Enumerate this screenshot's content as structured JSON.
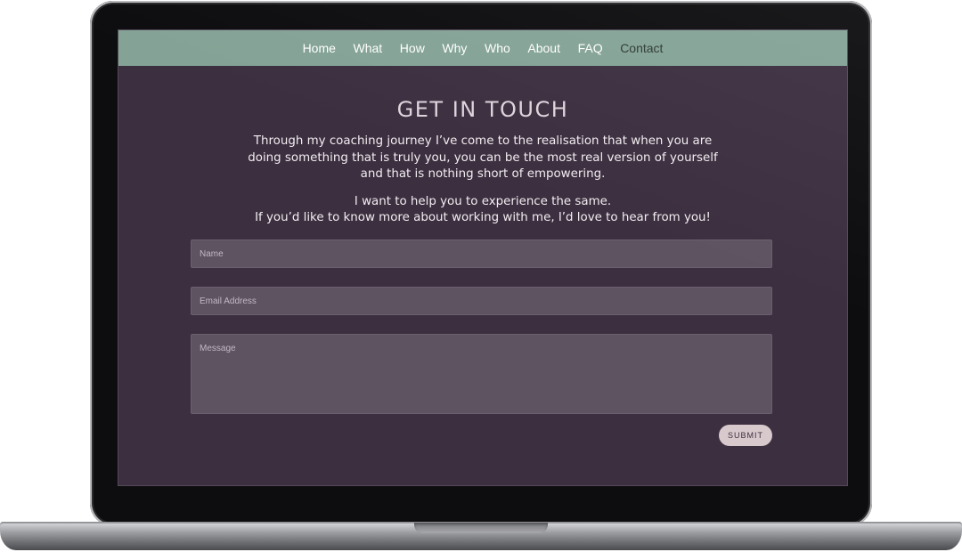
{
  "nav": {
    "items": [
      {
        "label": "Home"
      },
      {
        "label": "What"
      },
      {
        "label": "How"
      },
      {
        "label": "Why"
      },
      {
        "label": "Who"
      },
      {
        "label": "About"
      },
      {
        "label": "FAQ"
      },
      {
        "label": "Contact",
        "active": true
      }
    ]
  },
  "main": {
    "title": "GET IN TOUCH",
    "intro_lines": [
      "Through my coaching journey I’ve come to the realisation that when you are",
      "doing something that is truly you, you can be the most real version of yourself",
      "and that is nothing short of empowering."
    ],
    "intro2_lines": [
      "I want to help you to experience the same.",
      "If you’d like to know more about working with me, I’d love to hear from you!"
    ]
  },
  "form": {
    "name": {
      "placeholder": "Name",
      "value": ""
    },
    "email": {
      "placeholder": "Email Address",
      "value": ""
    },
    "message": {
      "placeholder": "Message",
      "value": ""
    },
    "submit_label": "SUBMIT"
  },
  "colors": {
    "nav_bg": "#84a396",
    "page_bg": "#3c2f40",
    "field_bg": "#5e5361",
    "submit_bg": "#d8c9cc"
  }
}
